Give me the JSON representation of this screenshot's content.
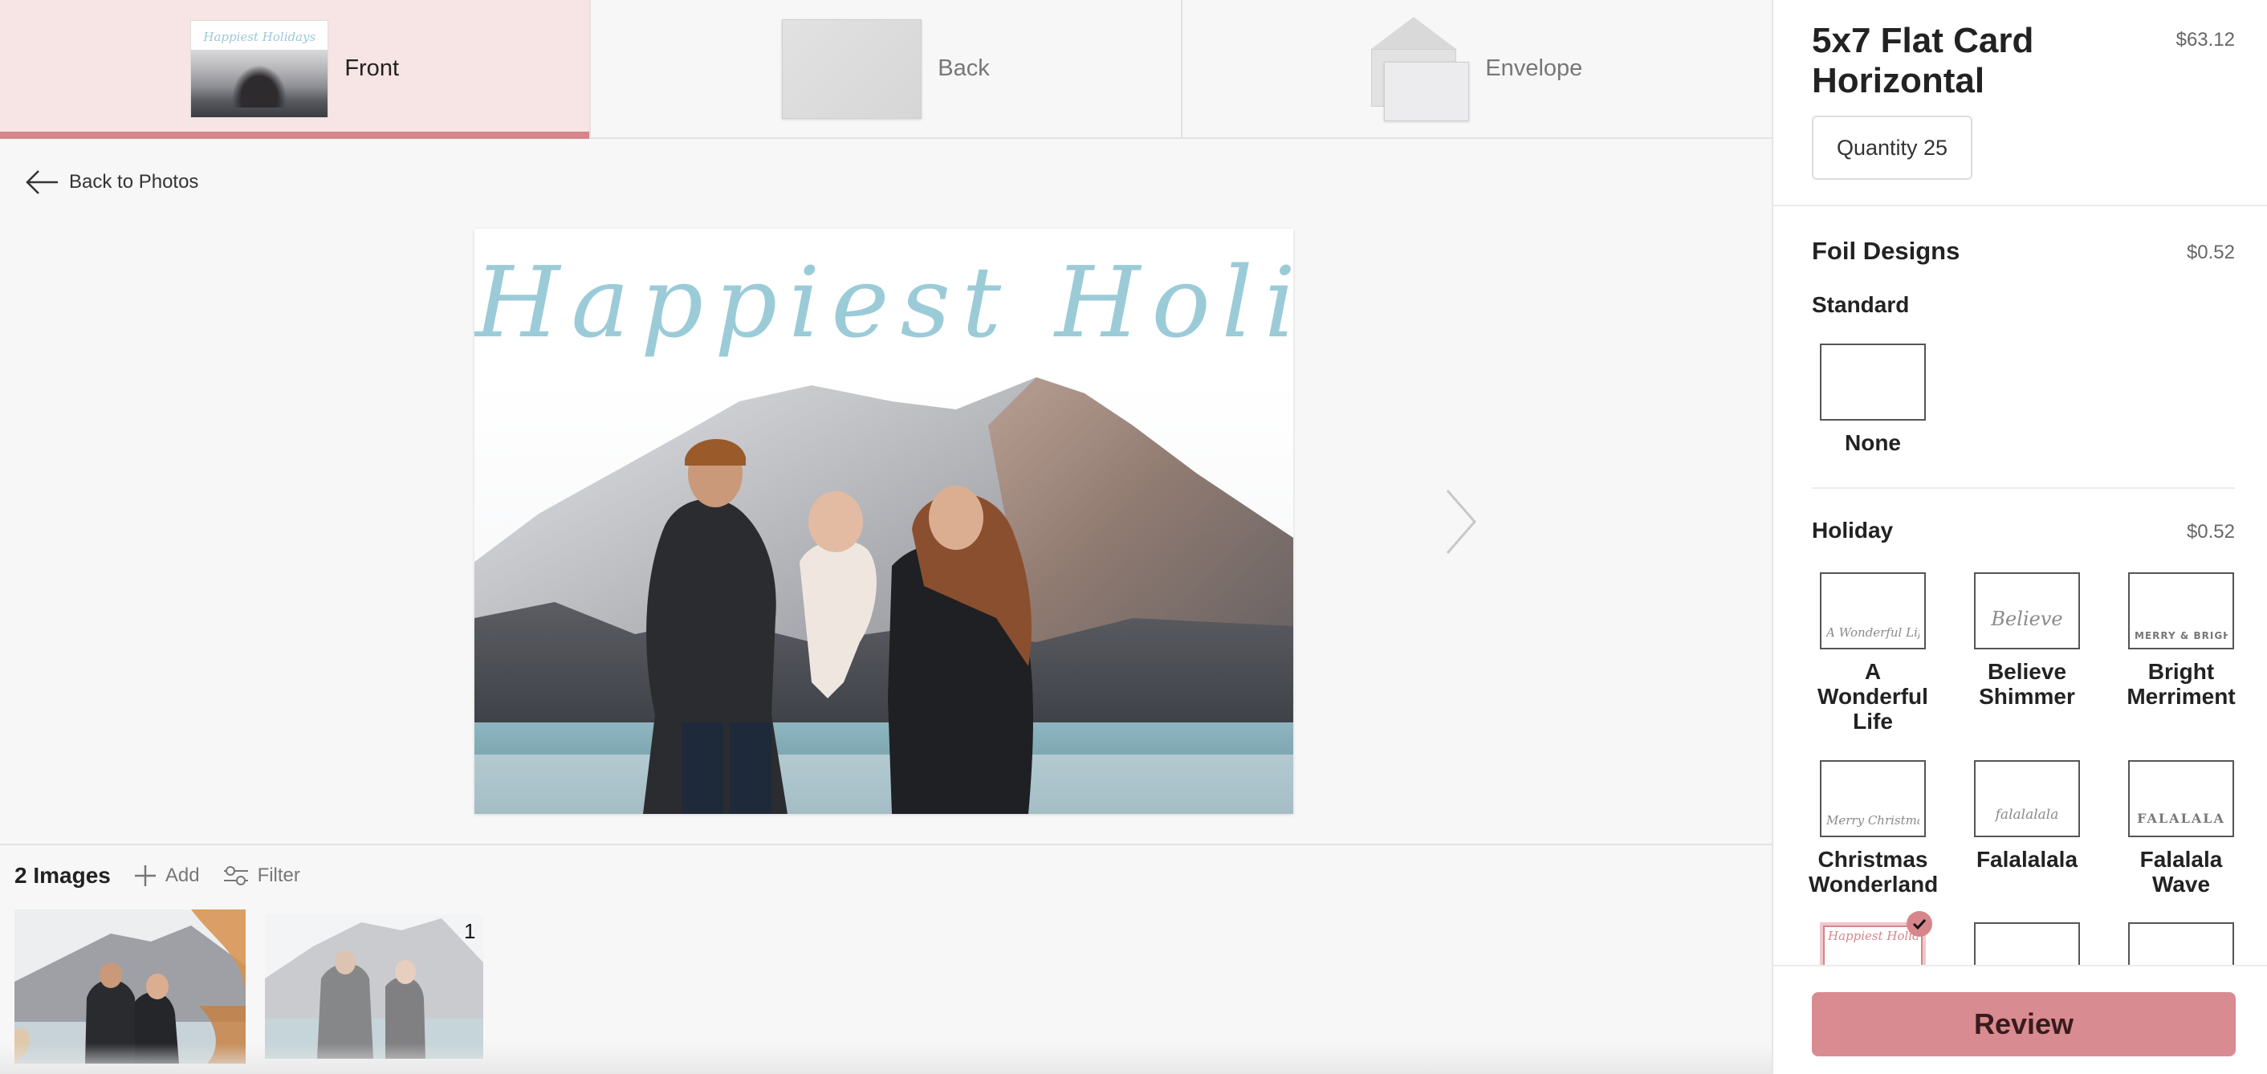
{
  "tabs": [
    {
      "label": "Front",
      "active": true
    },
    {
      "label": "Back",
      "active": false
    },
    {
      "label": "Envelope",
      "active": false
    }
  ],
  "nav": {
    "back_label": "Back to Photos"
  },
  "card": {
    "title_script": "Happiest Holidays"
  },
  "tray": {
    "count_label": "2 Images",
    "add_label": "Add",
    "filter_label": "Filter",
    "second_image_usage": "1"
  },
  "panel": {
    "product_name": "5x7 Flat Card Horizontal",
    "product_price": "$63.12",
    "quantity_label": "Quantity 25",
    "foil": {
      "title": "Foil Designs",
      "price": "$0.52",
      "standard_label": "Standard",
      "none_label": "None",
      "holiday_label": "Holiday",
      "holiday_price": "$0.52",
      "holiday_options": [
        {
          "name": "A Wonderful Life",
          "swatch_text": "A Wonderful Life"
        },
        {
          "name": "Believe Shimmer",
          "swatch_text": "Believe"
        },
        {
          "name": "Bright Merriment",
          "swatch_text": "MERRY & BRIGHT"
        },
        {
          "name": "Christmas Wonderland",
          "swatch_text": "Merry Christmas"
        },
        {
          "name": "Falalalala",
          "swatch_text": "falalalala"
        },
        {
          "name": "Falalala Wave",
          "swatch_text": "FALALALA"
        }
      ],
      "selected_swatch_text": "Happiest Holidays"
    },
    "review_label": "Review"
  },
  "colors": {
    "accent": "#d6858a",
    "tab_active_bg": "#f7e4e4",
    "script_blue": "#9ccbd8",
    "review_bg": "#d88b90"
  }
}
